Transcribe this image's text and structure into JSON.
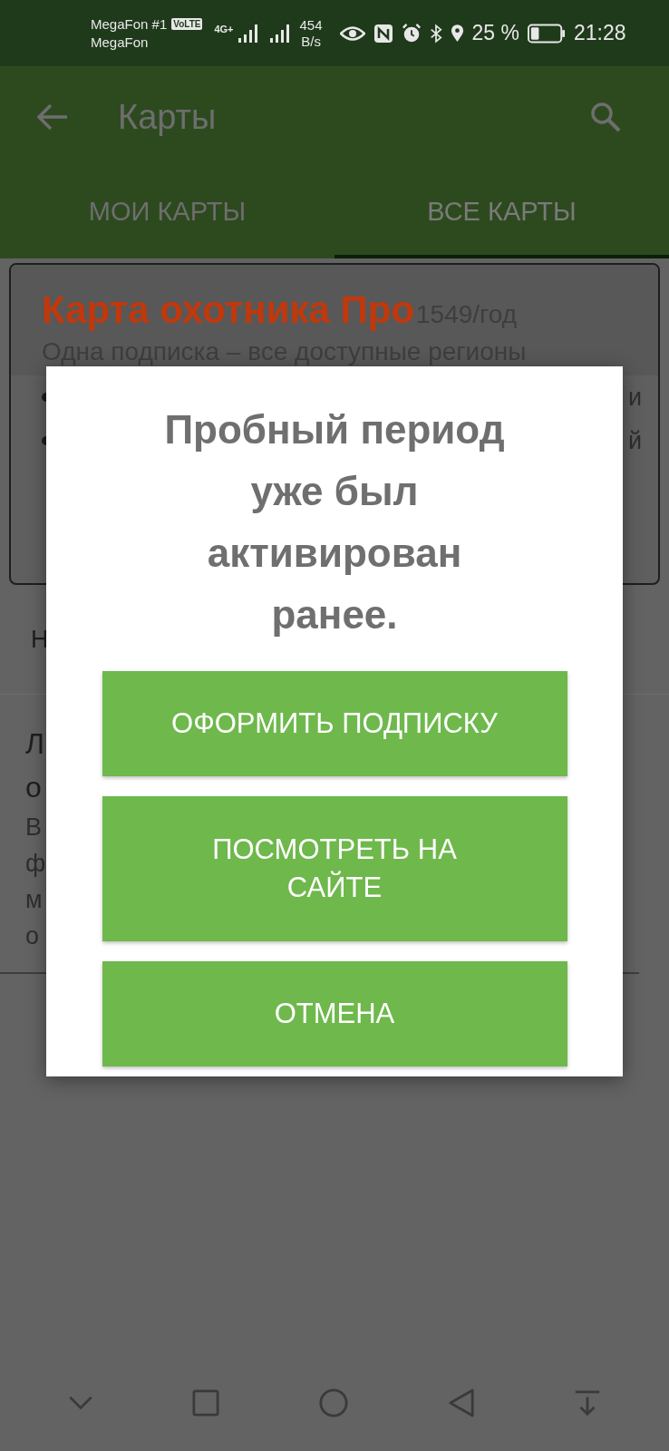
{
  "status_bar": {
    "carrier_1": "MegaFon #1",
    "volte": "VoLTE",
    "carrier_2": "MegaFon",
    "network": "4G+",
    "speed_value": "454",
    "speed_unit": "B/s",
    "battery": "25 %",
    "time": "21:28"
  },
  "app_bar": {
    "title": "Карты"
  },
  "tabs": [
    {
      "label": "МОИ КАРТЫ",
      "selected": false
    },
    {
      "label": "ВСЕ КАРТЫ",
      "selected": true
    }
  ],
  "card": {
    "title": "Карта охотника Про",
    "price": "1549/год",
    "subtitle": "Одна подписка – все доступные регионы",
    "bullets": [
      "и",
      "й"
    ]
  },
  "section_fragment": "Н",
  "item_fragments": {
    "title": [
      "Л",
      "о"
    ],
    "body": [
      "В",
      "ф",
      "м",
      "о"
    ]
  },
  "dialog": {
    "message": "Пробный период уже был активирован ранее.",
    "buttons": [
      "ОФОРМИТЬ ПОДПИСКУ",
      "ПОСМОТРЕТЬ НА САЙТЕ",
      "ОТМЕНА"
    ]
  }
}
